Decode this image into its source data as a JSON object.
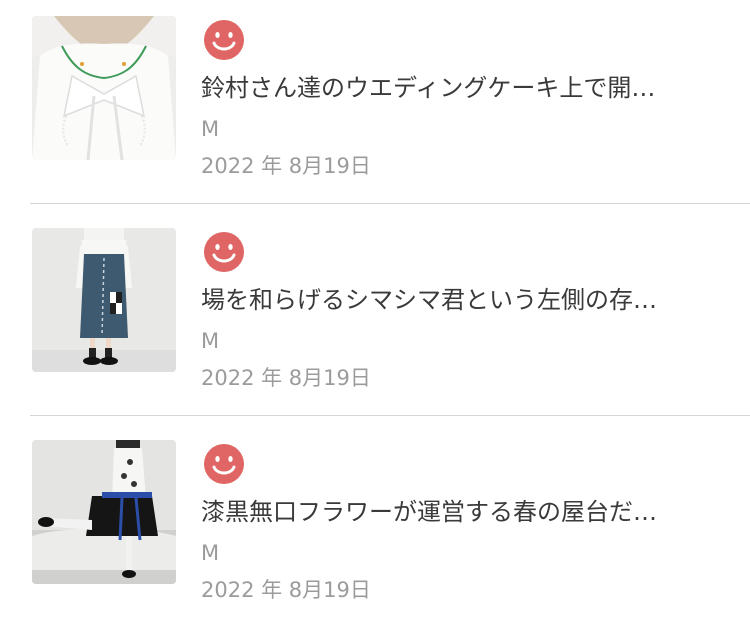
{
  "colors": {
    "avatar": "#e06666",
    "title_text": "#3a3a3a",
    "meta_text": "#9b9b9b",
    "divider": "#d6d6d6"
  },
  "items": [
    {
      "thumbnail_icon": "photo-white-blouse-with-bow",
      "avatar_icon": "smiley-face-icon",
      "title": "鈴村さん達のウエディングケーキ上で開…",
      "author": "M",
      "date": "2022 年 8月19日"
    },
    {
      "thumbnail_icon": "photo-denim-skirt-outfit",
      "avatar_icon": "smiley-face-icon",
      "title": "場を和らげるシマシマ君という左側の存…",
      "author": "M",
      "date": "2022 年 8月19日"
    },
    {
      "thumbnail_icon": "photo-seated-black-skirt-outfit",
      "avatar_icon": "smiley-face-icon",
      "title": "漆黒無口フラワーが運営する春の屋台だ…",
      "author": "M",
      "date": "2022 年 8月19日"
    }
  ]
}
